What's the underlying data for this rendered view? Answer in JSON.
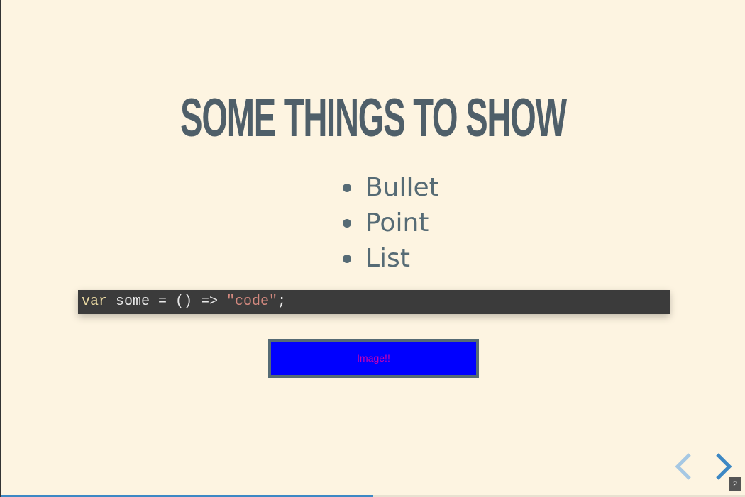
{
  "slide": {
    "title": "SOME THINGS TO SHOW",
    "bullets": [
      "Bullet",
      "Point",
      "List"
    ],
    "code": {
      "keyword": "var",
      "middle": " some = () => ",
      "string": "\"code\"",
      "end": ";"
    },
    "image_alt": "Image!!"
  },
  "controls": {
    "prev_icon": "chevron-left-icon",
    "next_icon": "chevron-right-icon",
    "slide_number": "2",
    "progress": 0.5
  },
  "colors": {
    "background": "#fdf4e1",
    "heading": "#4f5f69",
    "code_bg": "#3b3b3b",
    "image_fill": "#0000ff",
    "image_text": "#d000b0",
    "accent": "#3d88c4"
  }
}
